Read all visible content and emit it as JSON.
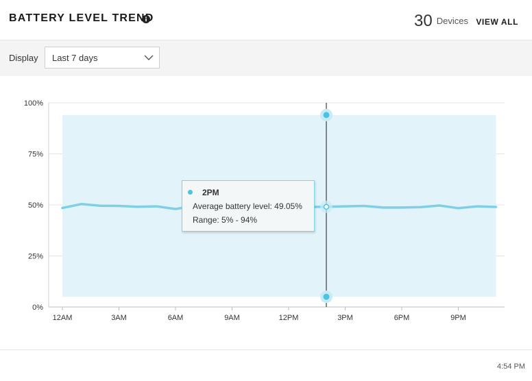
{
  "header": {
    "title": "BATTERY LEVEL TREND",
    "device_count": "30",
    "device_label": "Devices",
    "view_all": "VIEW ALL"
  },
  "display": {
    "label": "Display",
    "selected": "Last 7 days"
  },
  "tooltip": {
    "time": "2PM",
    "avg_text": "Average battery level: 49.05%",
    "range_text": "Range: 5% - 94%"
  },
  "footer": {
    "timestamp": "4:54 PM"
  },
  "colors": {
    "line": "#7fcfe6",
    "band": "#e3f3fa",
    "accent": "#4cc3e0"
  },
  "chart_data": {
    "type": "line",
    "title": "",
    "xlabel": "",
    "ylabel": "",
    "y_ticks": [
      "100%",
      "75%",
      "50%",
      "25%",
      "0%"
    ],
    "x_ticks": [
      "12AM",
      "3AM",
      "6AM",
      "9AM",
      "12PM",
      "3PM",
      "6PM",
      "9PM"
    ],
    "ylim": [
      0,
      100
    ],
    "x_hours": [
      0,
      1,
      2,
      3,
      4,
      5,
      6,
      7,
      8,
      9,
      10,
      11,
      12,
      13,
      14,
      15,
      16,
      17,
      18,
      19,
      20,
      21,
      22,
      23
    ],
    "series": [
      {
        "values": [
          48.5,
          50.4,
          49.6,
          49.5,
          49.1,
          49.3,
          48.0,
          49.6,
          49.6,
          49.5,
          49.5,
          49.5,
          49.4,
          49.0,
          49.05,
          49.3,
          49.5,
          48.7,
          48.7,
          48.9,
          49.7,
          48.4,
          49.3,
          49.0
        ]
      }
    ],
    "range_band": {
      "min": 5,
      "max": 94
    },
    "highlight": {
      "hour": 14,
      "label": "2PM",
      "avg": 49.05,
      "min": 5,
      "max": 94
    }
  }
}
